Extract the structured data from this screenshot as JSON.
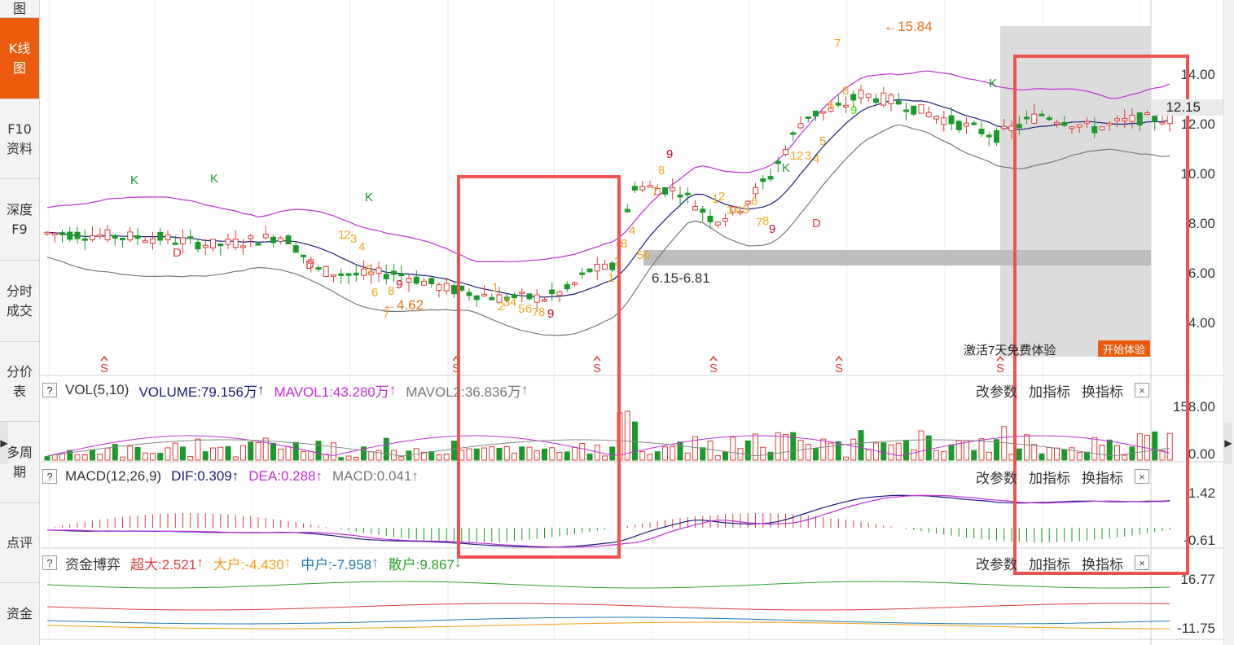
{
  "sidebar": {
    "items": [
      {
        "label": "图",
        "active": false
      },
      {
        "label": "K线图",
        "active": true
      },
      {
        "label": "F10资料",
        "active": false
      },
      {
        "label": "深度F9",
        "active": false
      },
      {
        "label": "分时成交",
        "active": false
      },
      {
        "label": "分价表",
        "active": false
      },
      {
        "label": "多周期",
        "active": false
      },
      {
        "label": "点评",
        "active": false
      },
      {
        "label": "资金",
        "active": false
      }
    ]
  },
  "colors": {
    "up": "#e03c3c",
    "down": "#1a9a2a",
    "mid": "#1a1a7a",
    "upper": "#c22dd8",
    "lower": "#777777",
    "accent": "#ea5b0c",
    "highlight": "#ef5350"
  },
  "main_chart": {
    "y_ticks": [
      "14.00",
      "12.00",
      "10.00",
      "8.00",
      "6.00",
      "4.00"
    ],
    "current_price": "12.15",
    "annotations": {
      "low": "←4.62",
      "high": "←15.84",
      "zone": "6.15-6.81"
    },
    "markers": [
      "K",
      "K",
      "K",
      "K",
      "K",
      "D",
      "D",
      "D"
    ],
    "td_counts": {
      "seq1": [
        "1",
        "2",
        "3",
        "4",
        "5",
        "6",
        "7",
        "8",
        "9"
      ],
      "seq2": [
        "1",
        "2",
        "3",
        "4",
        "5",
        "6",
        "7",
        "8",
        "9"
      ],
      "seq3": [
        "1",
        "2",
        "3",
        "4",
        "5",
        "6",
        "7",
        "8",
        "9"
      ],
      "seq4": [
        "1",
        "2",
        "3",
        "4",
        "5",
        "6",
        "7",
        "8",
        "9"
      ],
      "seq5": [
        "1",
        "2",
        "3",
        "4",
        "5",
        "6",
        "7",
        "8",
        "9"
      ],
      "seq6": [
        "1",
        "2",
        "3",
        "4",
        "5",
        "6",
        "7",
        "8",
        "9"
      ]
    },
    "s_icon_label": "S",
    "promo": {
      "text": "激活7天免费体验",
      "button": "开始体验"
    }
  },
  "vol_panel": {
    "help": "?",
    "name": "VOL(5,10)",
    "volume": "VOLUME:79.156万",
    "mavol1": "MAVOL1:43.280万",
    "mavol2": "MAVOL2:36.836万",
    "y_ticks": [
      "158.00",
      "0.00"
    ]
  },
  "macd_panel": {
    "help": "?",
    "name": "MACD(12,26,9)",
    "dif": "DIF:0.309",
    "dea": "DEA:0.288",
    "macd": "MACD:0.041",
    "y_ticks": [
      "1.42",
      "-0.61"
    ]
  },
  "fund_panel": {
    "help": "?",
    "name": "资金博弈",
    "super": "超大:2.521",
    "large": "大户:-4.430",
    "mid": "中户:-7.958",
    "retail": "散户:9.867",
    "y_ticks": [
      "16.77",
      "-11.75"
    ]
  },
  "panel_actions": {
    "modify": "改参数",
    "add": "加指标",
    "swap": "换指标",
    "close": "×"
  },
  "arrows": {
    "up": "↑",
    "down": "↓"
  }
}
